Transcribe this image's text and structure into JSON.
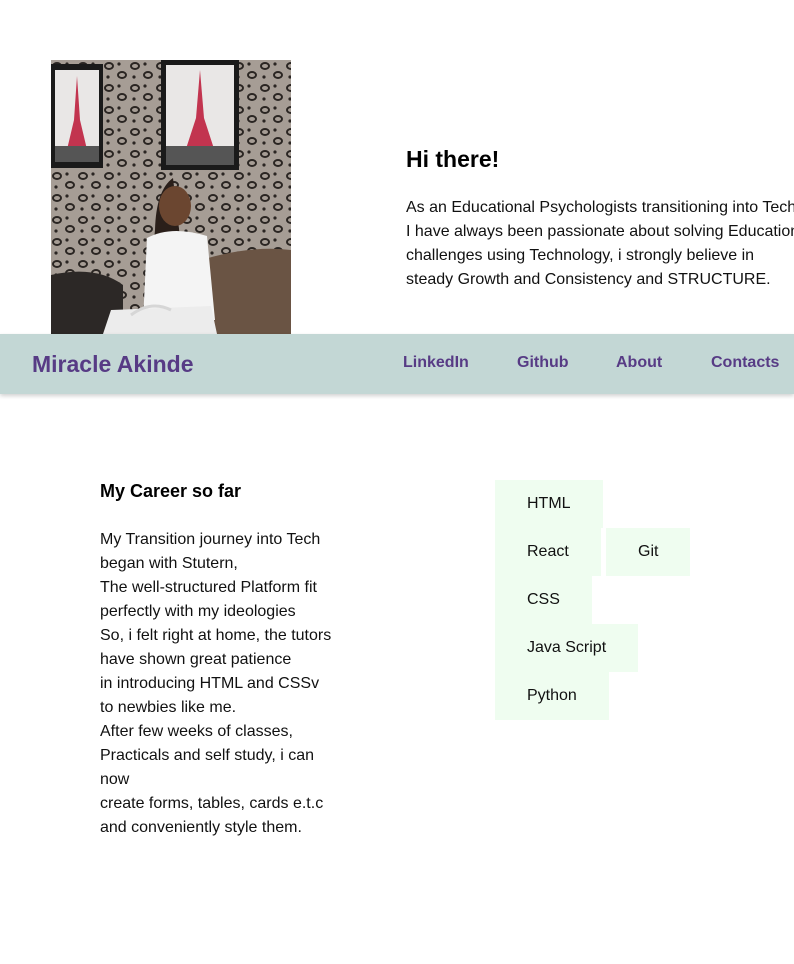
{
  "profile": {
    "photo_alt": "Miracle"
  },
  "hero": {
    "title": "Hi there!",
    "lines": [
      "As an Educational Psychologists transitioning into Tech",
      "I have always been passionate about solving Education",
      "challenges using Technology, i strongly believe in",
      "steady Growth and Consistency and STRUCTURE."
    ]
  },
  "navbar": {
    "brand": "Miracle Akinde",
    "links": [
      "LinkedIn",
      "Github",
      "About",
      "Contacts"
    ]
  },
  "career": {
    "title": "My Career so far",
    "lines": [
      "My Transition journey into Tech",
      "began with Stutern,",
      "The well-structured Platform fit",
      "perfectly with my ideologies",
      "So, i felt right at home, the tutors",
      "have shown great patience",
      "in introducing HTML and CSSv",
      "to newbies like me.",
      "After few weeks of classes,",
      "Practicals and self study, i can",
      "now",
      "create forms, tables, cards e.t.c",
      "and conveniently style them."
    ]
  },
  "skills": [
    "HTML",
    "React",
    "Git",
    "CSS",
    "Java Script",
    "Python"
  ],
  "colors": {
    "navbar_bg": "#c3d7d5",
    "brand": "#573b85",
    "skill_bg": "#effdf0"
  }
}
